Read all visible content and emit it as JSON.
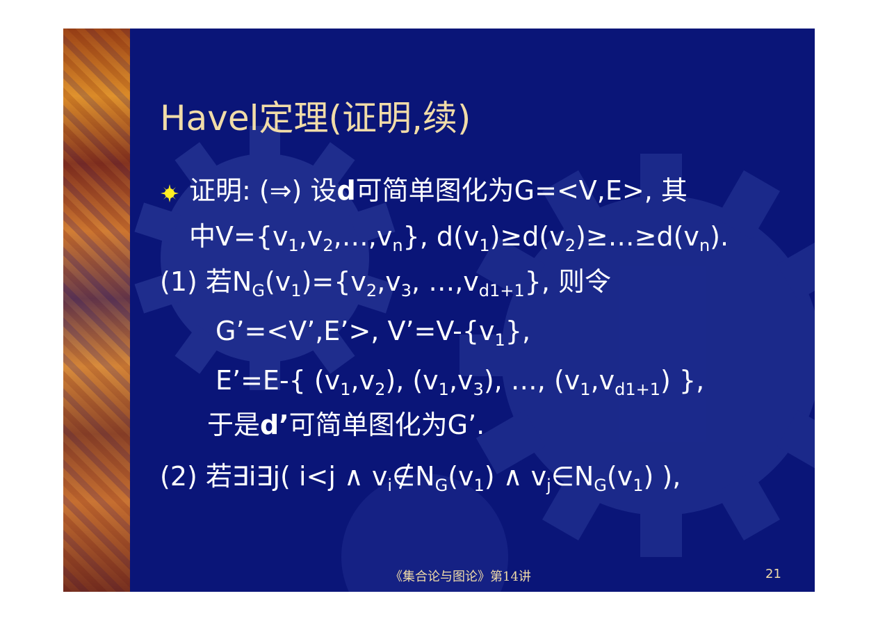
{
  "slide": {
    "title": "Havel定理(证明,续)",
    "footer_center": "《集合论与图论》第14讲",
    "footer_page": "21"
  },
  "colors": {
    "background": "#0a1578",
    "title": "#f1dca8",
    "body_text": "#ffffff",
    "footer_text": "#f1dca8",
    "bullet": "#ffee22"
  },
  "icons": [
    "sunburst-bullet-icon"
  ],
  "body": {
    "line1": {
      "a": "证明: (⇒) 设",
      "b": "d",
      "c": "可简单图化为G=<V,E>, 其"
    },
    "line2": {
      "a": "中V={v",
      "s1": "1",
      "b": ",v",
      "s2": "2",
      "c": ",…,v",
      "s3": "n",
      "d": "}, d(v",
      "s4": "1",
      "e": ")≥d(v",
      "s5": "2",
      "f": ")≥…≥d(v",
      "s6": "n",
      "g": ")."
    },
    "line3": {
      "a": "(1) 若N",
      "s1": "G",
      "b": "(v",
      "s2": "1",
      "c": ")={v",
      "s3": "2",
      "d": ",v",
      "s4": "3",
      "e": ", …,v",
      "s5": "d1+1",
      "f": "}, 则令"
    },
    "line4": {
      "a": "G’=<V’,E’>, V’=V-{v",
      "s1": "1",
      "b": "},"
    },
    "line5": {
      "a": "E’=E-{ (v",
      "s1": "1",
      "b": ",v",
      "s2": "2",
      "c": "), (v",
      "s3": "1",
      "d": ",v",
      "s4": "3",
      "e": "), …, (v",
      "s5": "1",
      "f": ",v",
      "s6": "d1+1",
      "g": ") },"
    },
    "line6": {
      "a": "于是",
      "b": "d’",
      "c": "可简单图化为G’."
    },
    "line7": {
      "a": "(2) 若∃i∃j( i<j ∧ v",
      "s1": "i",
      "b": "∉N",
      "s2": "G",
      "c": "(v",
      "s3": "1",
      "d": ") ∧ v",
      "s4": "j",
      "e": "∈N",
      "s5": "G",
      "f": "(v",
      "s6": "1",
      "g": ") ),"
    }
  }
}
